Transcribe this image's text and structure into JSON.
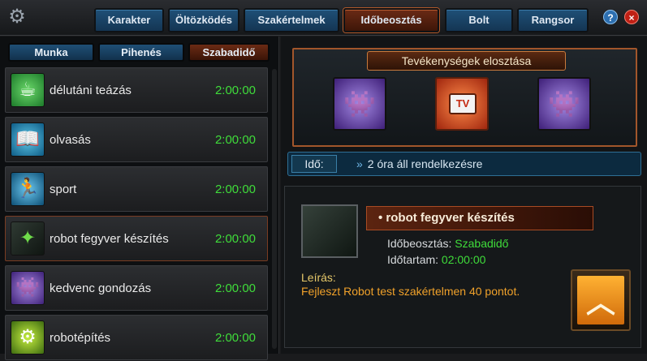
{
  "nav": {
    "tabs": [
      "Karakter",
      "Öltözködés",
      "Szakértelmek",
      "Időbeosztás",
      "Bolt",
      "Rangsor"
    ],
    "active_tab": "Időbeosztás",
    "help": "?",
    "close": "×"
  },
  "subtabs": {
    "items": [
      "Munka",
      "Pihenés",
      "Szabadidő"
    ],
    "active": "Szabadidő"
  },
  "activities": [
    {
      "name": "délutáni teázás",
      "time": "2:00:00",
      "icon": "tea-cup-icon"
    },
    {
      "name": "olvasás",
      "time": "2:00:00",
      "icon": "book-icon"
    },
    {
      "name": "sport",
      "time": "2:00:00",
      "icon": "runner-icon"
    },
    {
      "name": "robot fegyver készítés",
      "time": "2:00:00",
      "icon": "robot-weapon-icon"
    },
    {
      "name": "kedvenc gondozás",
      "time": "2:00:00",
      "icon": "pet-icon"
    },
    {
      "name": "robotépítés",
      "time": "2:00:00",
      "icon": "robot-build-icon"
    }
  ],
  "distribution": {
    "title": "Tevékenységek elosztása",
    "slots": [
      "pet-icon",
      "tv-icon",
      "pet-icon"
    ],
    "tv_text": "TV"
  },
  "time_bar": {
    "label": "Idő:",
    "value": "2 óra áll rendelkezésre"
  },
  "detail": {
    "title": "• robot fegyver készítés",
    "schedule_label": "Időbeosztás:",
    "schedule_value": "Szabadidő",
    "duration_label": "Időtartam:",
    "duration_value": "02:00:00",
    "desc_label": "Leírás:",
    "desc_text": "Fejleszt Robot test szakértelmen 40 pontot."
  },
  "colors": {
    "time_green": "#3fdc3a",
    "accent_orange": "#a2562b",
    "tab_blue": "#1f5077"
  }
}
